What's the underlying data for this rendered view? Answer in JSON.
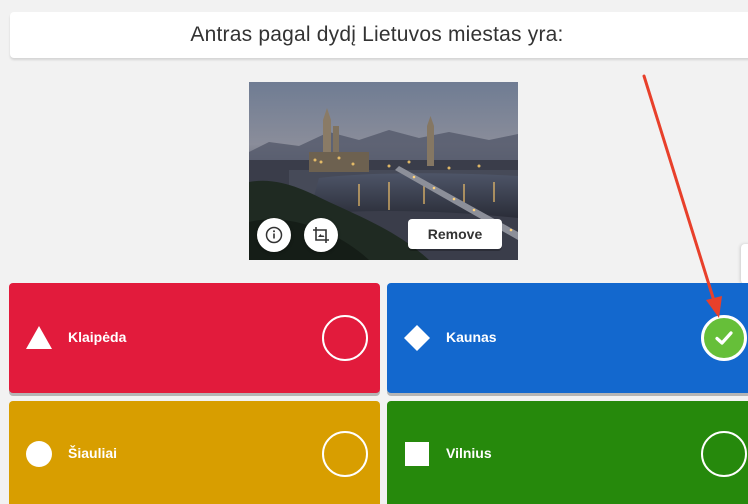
{
  "question": {
    "text": "Antras pagal dydį Lietuvos miestas yra:"
  },
  "media": {
    "remove_label": "Remove",
    "info_icon": "info-icon",
    "crop_icon": "crop-image-icon"
  },
  "answers": [
    {
      "label": "Klaipėda",
      "shape": "triangle",
      "color": "#e21b3c",
      "correct": false
    },
    {
      "label": "Kaunas",
      "shape": "diamond",
      "color": "#1368ce",
      "correct": true
    },
    {
      "label": "Šiauliai",
      "shape": "circle",
      "color": "#d89e00",
      "correct": false
    },
    {
      "label": "Vilnius",
      "shape": "square",
      "color": "#26890c",
      "correct": false
    }
  ],
  "colors": {
    "background": "#f2f2f2",
    "correct_check": "#66bf39",
    "annotation_arrow": "#e8402b"
  }
}
